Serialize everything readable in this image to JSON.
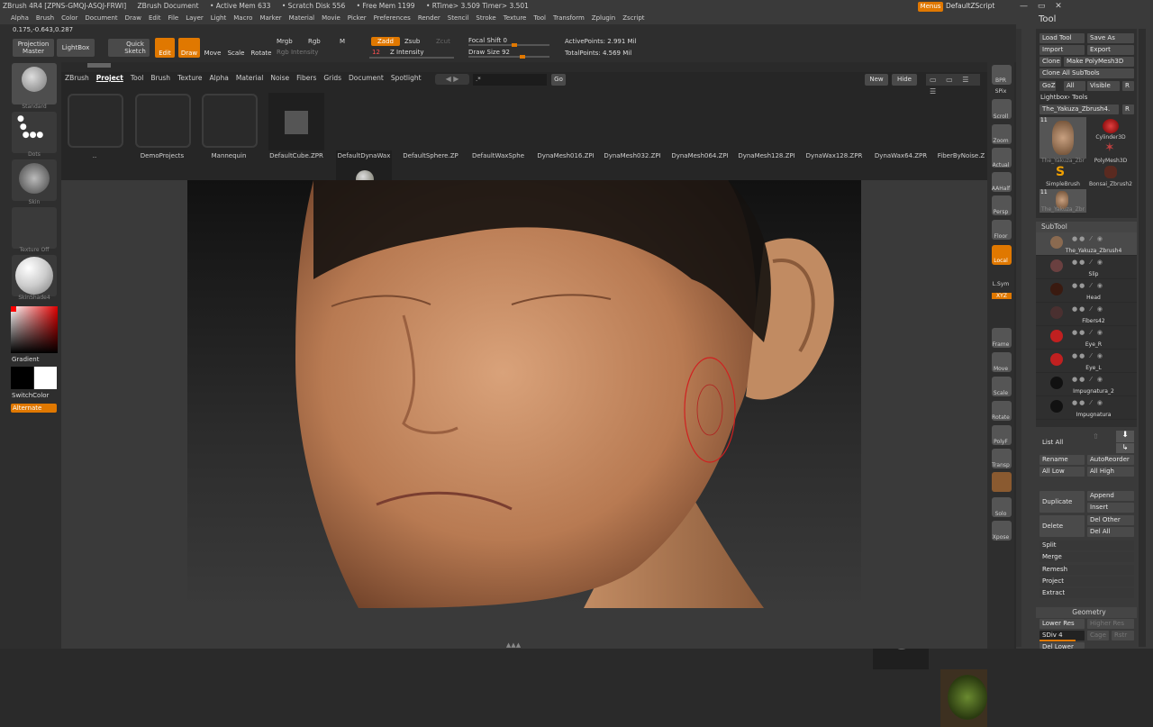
{
  "title": {
    "app": "ZBrush 4R4 [ZPNS-GMQJ-ASQJ-FRWI]",
    "document": "ZBrush Document",
    "active_mem": "• Active Mem 633",
    "scratch": "• Scratch Disk 556",
    "free_mem": "• Free Mem 1199",
    "rtimes": "• RTime> 3.509 Timer> 3.501",
    "menus_btn": "Menus",
    "script": "DefaultZScript"
  },
  "menu": [
    "Alpha",
    "Brush",
    "Color",
    "Document",
    "Draw",
    "Edit",
    "File",
    "Layer",
    "Light",
    "Macro",
    "Marker",
    "Material",
    "Movie",
    "Picker",
    "Preferences",
    "Render",
    "Stencil",
    "Stroke",
    "Texture",
    "Tool",
    "Transform",
    "Zplugin",
    "Zscript"
  ],
  "coords": "0.175,-0.643,0.287",
  "toolbar": {
    "projection": "Projection Master",
    "lightbox": "LightBox",
    "quicksketch": "Quick Sketch",
    "edit": "Edit",
    "draw": "Draw",
    "move": "Move",
    "scale": "Scale",
    "rotate": "Rotate",
    "mrgb": "Mrgb",
    "rgb": "Rgb",
    "m": "M",
    "rgb_intensity": "Rgb Intensity",
    "zadd": "Zadd",
    "zsub": "Zsub",
    "zcut": "Zcut",
    "z_intensity_value": "12",
    "z_intensity": "Z Intensity",
    "focal_shift": "Focal Shift 0",
    "draw_size": "Draw Size 92",
    "active_points": "ActivePoints: 2.991 Mil",
    "total_points": "TotalPoints: 4.569 Mil"
  },
  "lightbox_tabs": [
    "ZBrush",
    "Project",
    "Tool",
    "Brush",
    "Texture",
    "Alpha",
    "Material",
    "Noise",
    "Fibers",
    "Grids",
    "Document",
    "Spotlight"
  ],
  "lightbox_search": ".*",
  "lightbox_go": "Go",
  "lightbox_new": "New",
  "lightbox_hide": "Hide",
  "lightbox_items": [
    "..",
    "DemoProjects",
    "Mannequin",
    "DefaultCube.ZPR",
    "DefaultDynaWax",
    "DefaultSphere.ZP",
    "DefaultWaxSphe",
    "DynaMesh016.ZPI",
    "DynaMesh032.ZPI",
    "DynaMesh064.ZPI",
    "DynaMesh128.ZPI",
    "DynaWax128.ZPR",
    "DynaWax64.ZPR",
    "FiberByNoise.Z"
  ],
  "left_shelf": {
    "brush": "Standard",
    "stroke": "Dots",
    "alpha": "Skin",
    "texture": "Texture Off",
    "material": "SkinShade4",
    "gradient": "Gradient",
    "switchcolor": "SwitchColor",
    "alternate": "Alternate"
  },
  "right_shelf": [
    "BPR",
    "SPix",
    "Scroll",
    "Zoom",
    "Actual",
    "AAHalf",
    "Persp",
    "Floor",
    "Local",
    "L.Sym",
    "XYZ",
    "Frame",
    "Move",
    "Scale",
    "Rotate",
    "PolyF",
    "Transp",
    "Solo",
    "Xpose"
  ],
  "tool_panel": {
    "header": "Tool",
    "load_tool": "Load Tool",
    "save_as": "Save As",
    "import": "Import",
    "export": "Export",
    "clone": "Clone",
    "make_polymesh": "Make PolyMesh3D",
    "clone_all": "Clone All SubTools",
    "goz": "GoZ",
    "all": "All",
    "visible": "Visible",
    "r": "R",
    "lightbox_tools": "Lightbox› Tools",
    "current_tool": "The_Yakuza_Zbrush4.",
    "tool_count": "11",
    "tool_names": [
      "The_Yakuza_Zbr",
      "Cylinder3D",
      "PolyMesh3D",
      "SimpleBrush",
      "Bonsai_Zbrush2",
      "The_Yakuza_Zbr"
    ]
  },
  "subtool": {
    "header": "SubTool",
    "items": [
      "The_Yakuza_Zbrush4",
      "Slip",
      "Head",
      "Fibers42",
      "Eye_R",
      "Eye_L",
      "Impugnatura_2",
      "Impugnatura"
    ],
    "list_all": "List All",
    "rename": "Rename",
    "autoreorder": "AutoReorder",
    "all_low": "All Low",
    "all_high": "All High",
    "duplicate": "Duplicate",
    "append": "Append",
    "insert": "Insert",
    "delete": "Delete",
    "del_other": "Del Other",
    "del_all": "Del All",
    "split": "Split",
    "merge": "Merge",
    "remesh": "Remesh",
    "project": "Project",
    "extract": "Extract"
  },
  "geometry": {
    "header": "Geometry",
    "lower_res": "Lower Res",
    "higher_res": "Higher Res",
    "sdiv": "SDiv 4",
    "cage": "Cage",
    "rstr": "Rstr",
    "del_lower": "Del Lower"
  },
  "colors": {
    "accent": "#e07800",
    "panel": "#3a3a3a",
    "bg": "#2a2a2a"
  }
}
